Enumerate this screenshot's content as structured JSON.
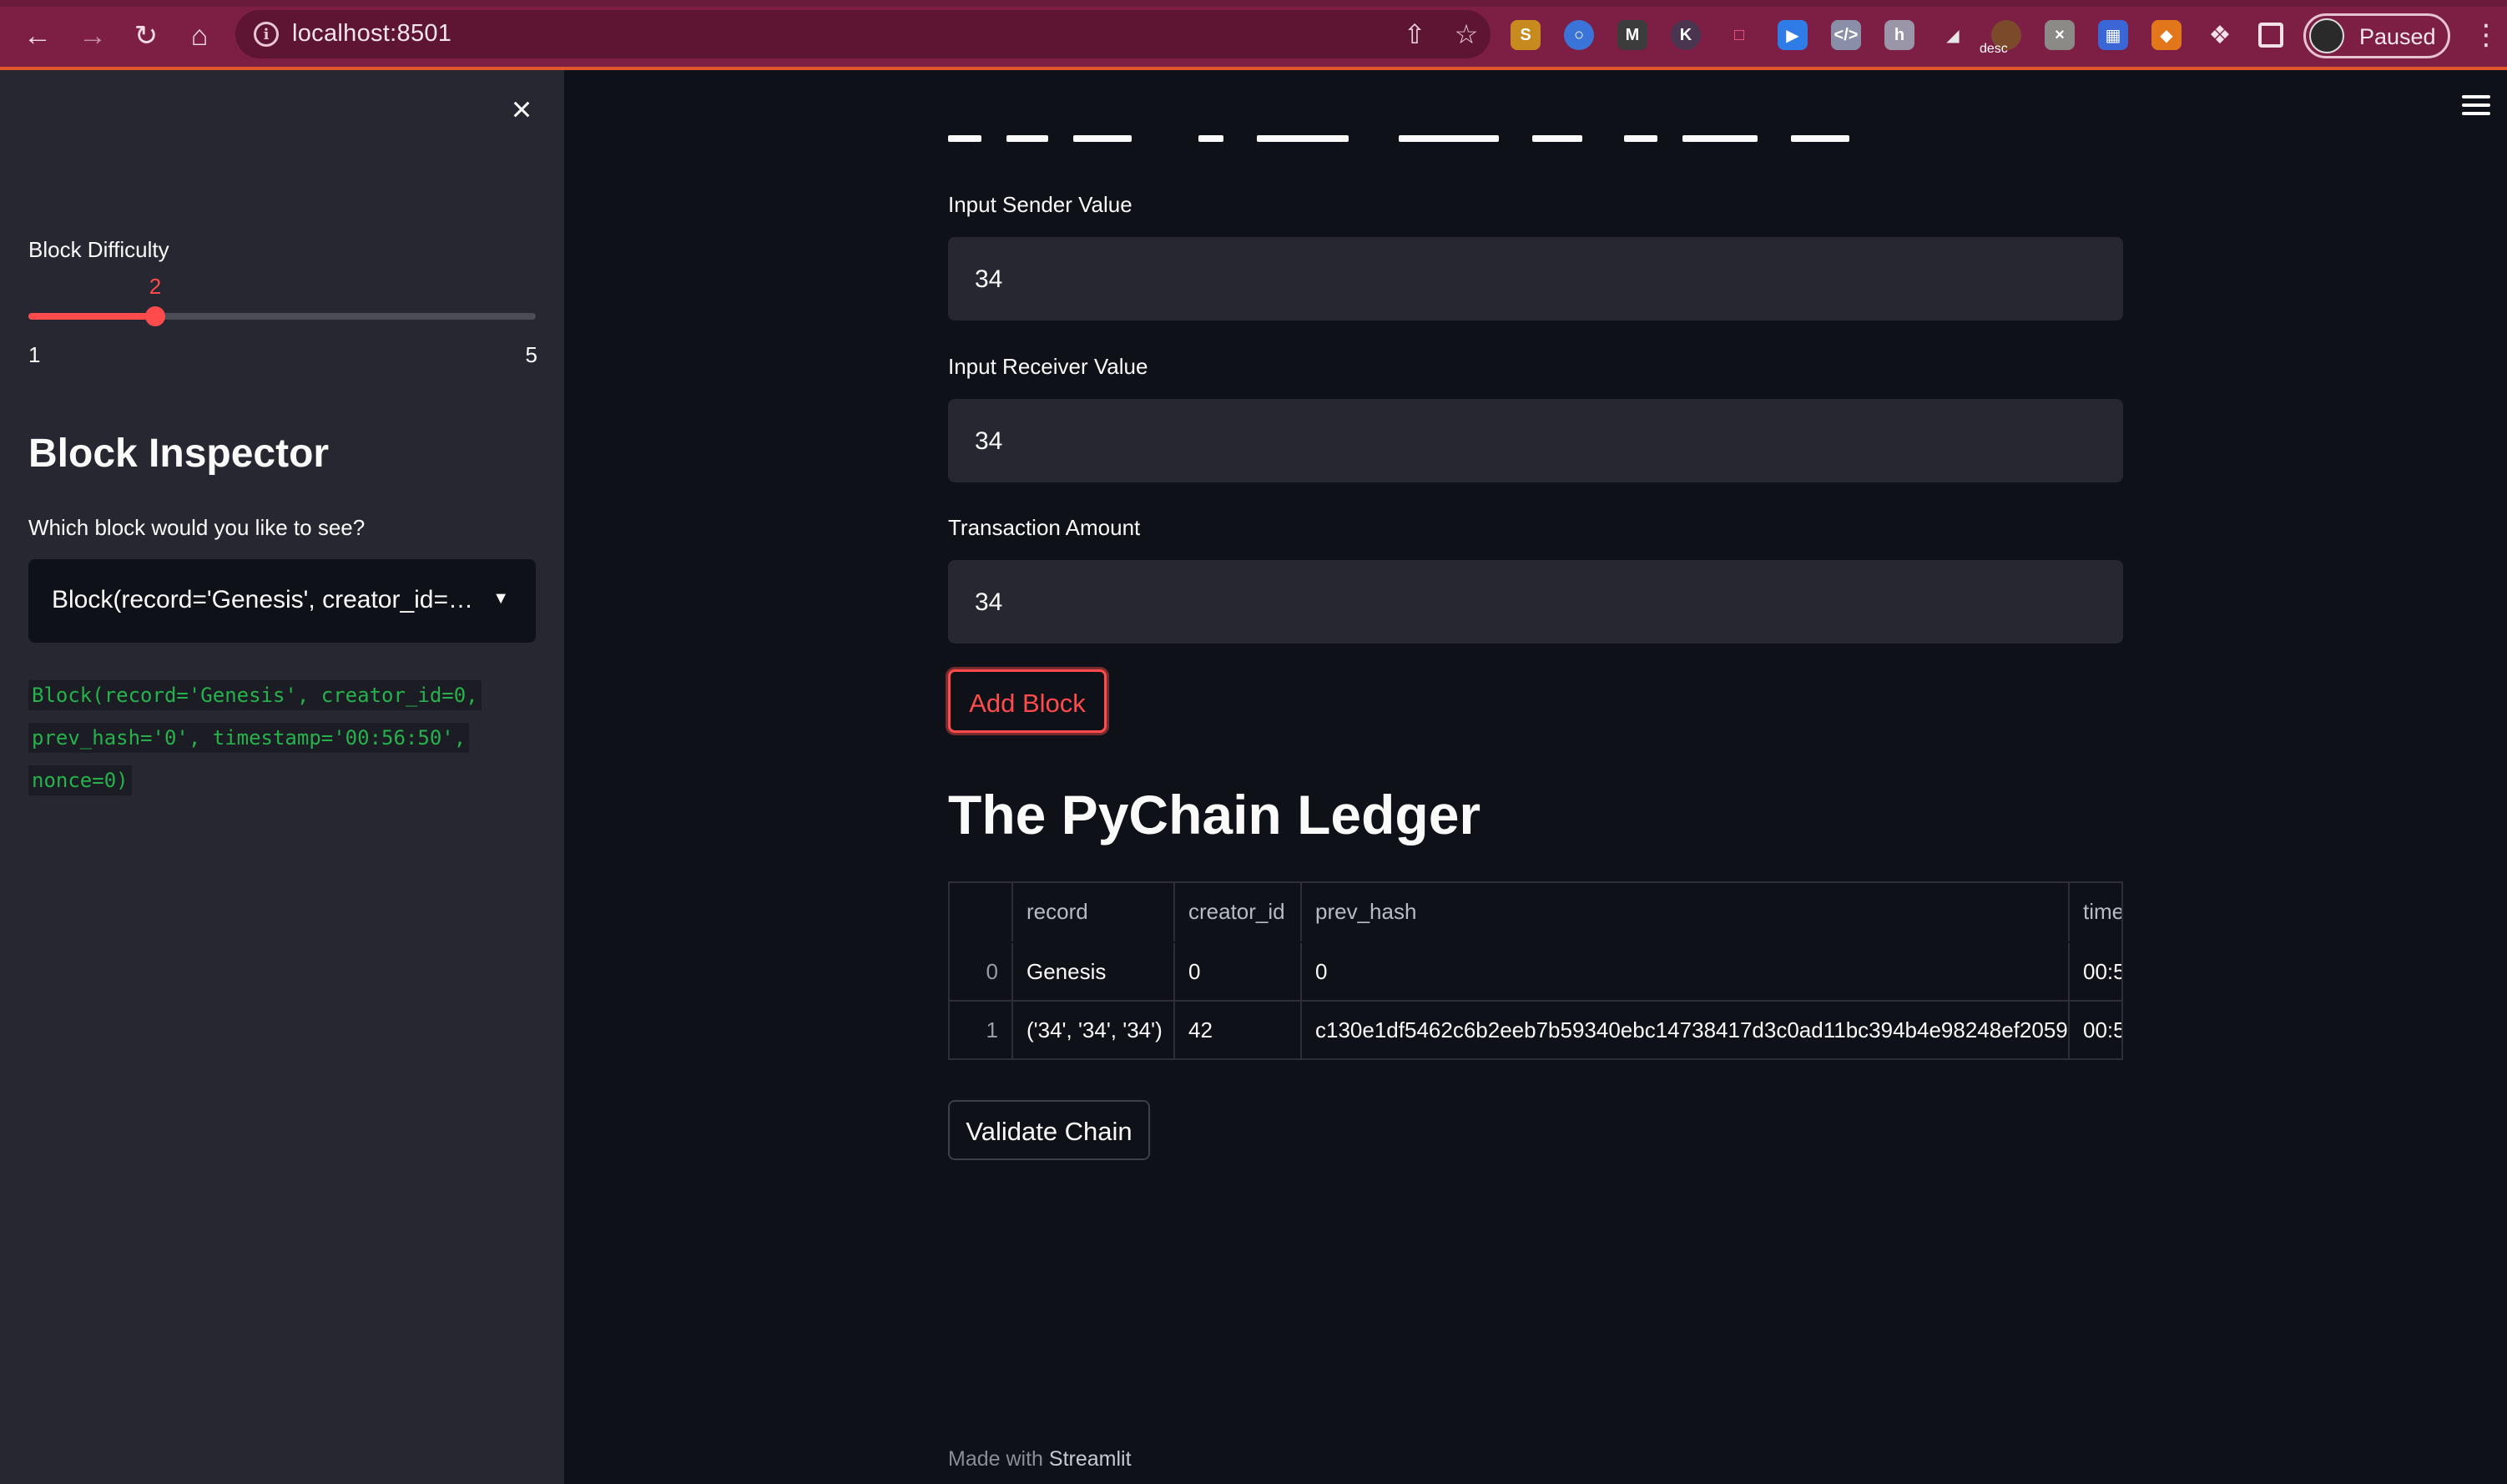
{
  "browser": {
    "url": "localhost:8501",
    "profile_label": "Paused",
    "desc_extension_label": "desc"
  },
  "sidebar": {
    "slider": {
      "label": "Block Difficulty",
      "value": 2,
      "min": 1,
      "max": 5,
      "accent": "#ff4b4b"
    },
    "heading": "Block Inspector",
    "select_label": "Which block would you like to see?",
    "select_value": "Block(record='Genesis', creator_id=0, prev_hash='0', timestamp='00:56:50', nonce=0)",
    "code_lines": [
      "Block(record='Genesis', creator_id=0,",
      "prev_hash='0', timestamp='00:56:50',",
      "nonce=0)"
    ]
  },
  "main": {
    "inputs": [
      {
        "label": "Input Sender Value",
        "value": "34"
      },
      {
        "label": "Input Receiver Value",
        "value": "34"
      },
      {
        "label": "Transaction Amount",
        "value": "34"
      }
    ],
    "add_block_label": "Add Block",
    "ledger_title": "The PyChain Ledger",
    "table": {
      "columns": [
        "",
        "record",
        "creator_id",
        "prev_hash",
        "time"
      ],
      "rows": [
        [
          "0",
          "Genesis",
          "0",
          "0",
          "00:5"
        ],
        [
          "1",
          "('34', '34', '34')",
          "42",
          "c130e1df5462c6b2eeb7b59340ebc14738417d3c0ad11bc394b4e98248ef2059",
          "00:5"
        ]
      ]
    },
    "validate_label": "Validate Chain",
    "footer_prefix": "Made with",
    "footer_brand": "Streamlit"
  },
  "colors": {
    "chrome": "#7d1f45",
    "sidebar_bg": "#262730",
    "main_bg": "#0e1117",
    "accent": "#ff4b4b",
    "code_green": "#26b24b"
  }
}
